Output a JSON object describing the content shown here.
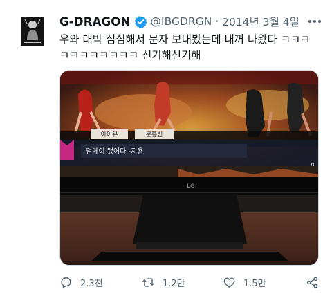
{
  "author": {
    "display_name": "G-DRAGON",
    "handle": "@IBGDRGN",
    "date": "2014년 3월 4일",
    "separator": "·",
    "avatar_icon": "profile-photo",
    "verified_icon": "verified-badge-icon",
    "verified_color": "#1d9bf0"
  },
  "tweet": {
    "text_line1": "우와 대박 심심해서 문자 보내봤는데 내꺼 나왔다 ㅋㅋㅋ",
    "text_line2": "ㅋㅋㅋㅋㅋㅋㅋㅋ 신기해신기해"
  },
  "media": {
    "tv_banner_left": "아이유",
    "tv_banner_right": "분홍신",
    "tv_caption": "엄메이 됐어다 -지용",
    "tv_corner": "8",
    "tv_brand": "LG"
  },
  "actions": {
    "replies": "2.3천",
    "retweets": "1.2만",
    "likes": "1.5만"
  },
  "colors": {
    "text": "#0f1419",
    "secondary": "#536471",
    "accent": "#1d9bf0"
  }
}
